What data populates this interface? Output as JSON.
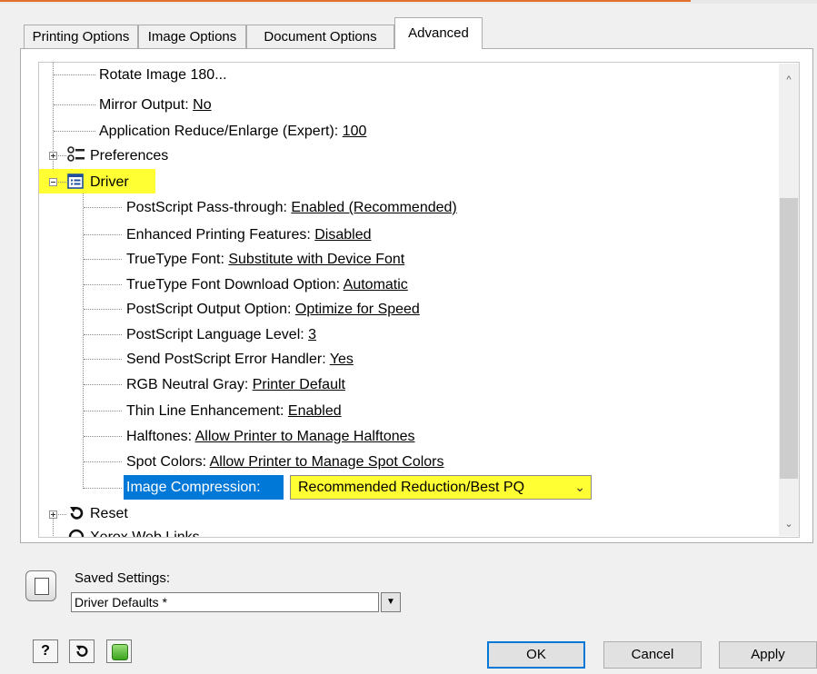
{
  "tabs": [
    "Printing Options",
    "Image Options",
    "Document Options",
    "Advanced"
  ],
  "tree": {
    "rotate": {
      "label": "Rotate Image 180..."
    },
    "mirror": {
      "label": "Mirror Output: ",
      "value": "No"
    },
    "reduce": {
      "label": "Application Reduce/Enlarge (Expert): ",
      "value": "100"
    },
    "preferences": "Preferences",
    "driver": "Driver",
    "items": [
      {
        "label": "PostScript Pass-through: ",
        "value": "Enabled (Recommended)"
      },
      {
        "label": "Enhanced Printing Features: ",
        "value": "Disabled"
      },
      {
        "label": "TrueType Font: ",
        "value": "Substitute with Device Font"
      },
      {
        "label": "TrueType Font Download Option: ",
        "value": "Automatic"
      },
      {
        "label": "PostScript Output Option: ",
        "value": "Optimize for Speed"
      },
      {
        "label": "PostScript Language Level: ",
        "value": "3"
      },
      {
        "label": "Send PostScript Error Handler: ",
        "value": "Yes"
      },
      {
        "label": "RGB Neutral Gray: ",
        "value": "Printer Default"
      },
      {
        "label": "Thin Line Enhancement: ",
        "value": "Enabled"
      },
      {
        "label": "Halftones: ",
        "value": "Allow Printer to Manage Halftones"
      },
      {
        "label": "Spot Colors: ",
        "value": "Allow Printer to Manage Spot Colors"
      }
    ],
    "image_compression": {
      "label": "Image Compression:",
      "value": "Recommended Reduction/Best PQ"
    },
    "reset": "Reset",
    "weblinks_partial": "Xerox Web Links"
  },
  "saved_settings": {
    "label": "Saved Settings:",
    "value": "Driver Defaults *"
  },
  "buttons": {
    "help": "?",
    "ok": "OK",
    "cancel": "Cancel",
    "apply": "Apply"
  },
  "colors": {
    "highlight": "#ffff33",
    "selection": "#0078d7",
    "accent": "#e2712b"
  }
}
